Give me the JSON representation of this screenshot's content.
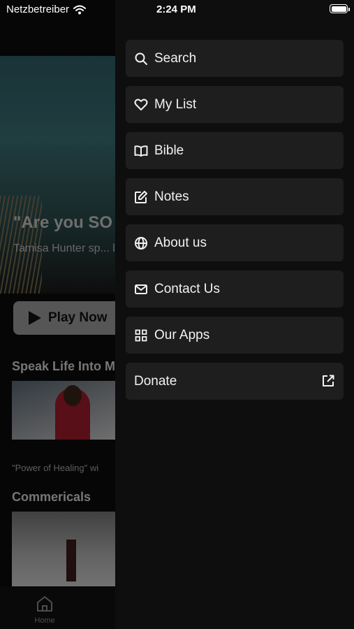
{
  "status_bar": {
    "carrier": "Netzbetreiber",
    "time": "2:24 PM"
  },
  "background": {
    "hero_title": "\"Are you SO",
    "hero_description": "Tamisa Hunter sp... life of \"WHY YOU... were BORN to st...",
    "play_label": "Play Now",
    "section1_title": "Speak Life Into M",
    "section1_caption": "\"Power of Healing\" wi",
    "section2_title": "Commericals",
    "tab_home_label": "Home"
  },
  "menu": {
    "items": [
      {
        "label": "Search",
        "icon": "search-icon"
      },
      {
        "label": "My List",
        "icon": "heart-icon"
      },
      {
        "label": "Bible",
        "icon": "book-icon"
      },
      {
        "label": "Notes",
        "icon": "edit-icon"
      },
      {
        "label": "About us",
        "icon": "globe-icon"
      },
      {
        "label": "Contact Us",
        "icon": "mail-icon"
      },
      {
        "label": "Our Apps",
        "icon": "grid-icon"
      },
      {
        "label": "Donate",
        "icon": "external-link-icon"
      }
    ]
  },
  "colors": {
    "menu_background": "#0e0e0e",
    "menu_item_background": "#1e1e1e",
    "text": "#f2f2f2"
  }
}
